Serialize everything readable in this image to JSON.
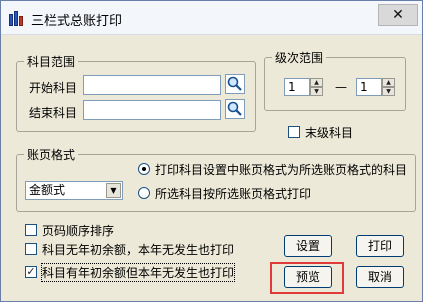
{
  "window": {
    "title": "三栏式总账打印",
    "close_glyph": "✕"
  },
  "subject_range": {
    "legend": "科目范围",
    "start_label": "开始科目",
    "start_value": "",
    "end_label": "结束科目",
    "end_value": ""
  },
  "level_range": {
    "legend": "级次范围",
    "from_value": "1",
    "separator": "—",
    "to_value": "1",
    "leaf_only_label": "末级科目",
    "leaf_only_checked": false
  },
  "page_format": {
    "legend": "账页格式",
    "format_select_value": "金额式",
    "option_use_subject_format": "打印科目设置中账页格式为所选账页格式的科目",
    "option_use_subject_format_selected": true,
    "option_print_selected": "所选科目按所选账页格式打印",
    "option_print_selected_selected": false
  },
  "options": {
    "sequential_pages_label": "页码顺序排序",
    "sequential_pages_checked": false,
    "no_opening_balance_label": "科目无年初余额，本年无发生也打印",
    "no_opening_balance_checked": false,
    "has_opening_balance_label": "科目有年初余额但本年无发生也打印",
    "has_opening_balance_checked": true
  },
  "buttons": {
    "settings": "设置",
    "print": "打印",
    "preview": "预览",
    "cancel": "取消"
  },
  "icons": {
    "app": "ledger-books-icon",
    "close": "close-icon",
    "browse": "magnifier-icon",
    "spin": "spin-updown-icon",
    "dropdown": "chevron-down-icon",
    "check": "checkmark-icon"
  },
  "colors": {
    "highlight": "#e03a3a",
    "window_bg": "#ece9d8",
    "border_blue": "#7f9db9"
  }
}
